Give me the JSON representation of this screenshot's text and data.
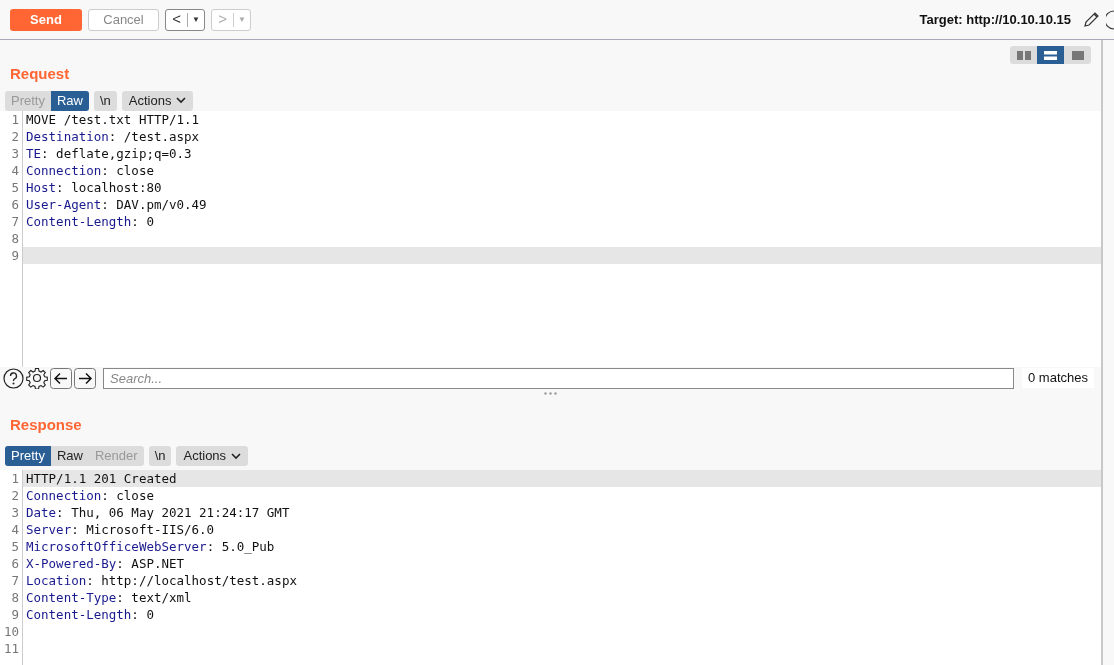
{
  "toolbar": {
    "send": "Send",
    "cancel": "Cancel",
    "back": "<",
    "back_menu": "▼",
    "forward": ">",
    "forward_menu": "▼",
    "target": "Target: http://10.10.10.15"
  },
  "layout_toggle": [
    {
      "kind": "columns",
      "selected": false
    },
    {
      "kind": "rows",
      "selected": true
    },
    {
      "kind": "single",
      "selected": false
    }
  ],
  "request": {
    "title": "Request",
    "view_tabs": [
      {
        "label": "Pretty",
        "selected": false,
        "disabled": true
      },
      {
        "label": "Raw",
        "selected": true,
        "disabled": false
      }
    ],
    "newline": "\\n",
    "actions": "Actions",
    "lines": [
      {
        "number": "1",
        "value": "MOVE /test.txt HTTP/1.1",
        "current": false
      },
      {
        "number": "2",
        "key": "Destination",
        "value": ": /test.aspx",
        "current": false
      },
      {
        "number": "3",
        "key": "TE",
        "value": ": deflate,gzip;q=0.3",
        "current": false
      },
      {
        "number": "4",
        "key": "Connection",
        "value": ": close",
        "current": false
      },
      {
        "number": "5",
        "key": "Host",
        "value": ": localhost:80",
        "current": false
      },
      {
        "number": "6",
        "key": "User-Agent",
        "value": ": DAV.pm/v0.49",
        "current": false
      },
      {
        "number": "7",
        "key": "Content-Length",
        "value": ": 0",
        "current": false
      },
      {
        "number": "8",
        "current": false
      },
      {
        "number": "9",
        "current": true
      }
    ],
    "search": {
      "placeholder": "Search...",
      "matches": "0 matches"
    }
  },
  "response": {
    "title": "Response",
    "view_tabs": [
      {
        "label": "Pretty",
        "selected": true,
        "disabled": false
      },
      {
        "label": "Raw",
        "selected": false,
        "disabled": false
      },
      {
        "label": "Render",
        "selected": false,
        "disabled": true
      }
    ],
    "newline": "\\n",
    "actions": "Actions",
    "lines": [
      {
        "number": "1",
        "value": "HTTP/1.1 201 Created",
        "current": true
      },
      {
        "number": "2",
        "key": "Connection",
        "value": ": close",
        "current": false
      },
      {
        "number": "3",
        "key": "Date",
        "value": ": Thu, 06 May 2021 21:24:17 GMT",
        "current": false
      },
      {
        "number": "4",
        "key": "Server",
        "value": ": Microsoft-IIS/6.0",
        "current": false
      },
      {
        "number": "5",
        "key": "MicrosoftOfficeWebServer",
        "value": ": 5.0_Pub",
        "current": false
      },
      {
        "number": "6",
        "key": "X-Powered-By",
        "value": ": ASP.NET",
        "current": false
      },
      {
        "number": "7",
        "key": "Location",
        "value": ": http://localhost/test.aspx",
        "current": false
      },
      {
        "number": "8",
        "key": "Content-Type",
        "value": ": text/xml",
        "current": false
      },
      {
        "number": "9",
        "key": "Content-Length",
        "value": ": 0",
        "current": false
      },
      {
        "number": "10",
        "current": false
      },
      {
        "number": "11",
        "current": false
      }
    ]
  }
}
